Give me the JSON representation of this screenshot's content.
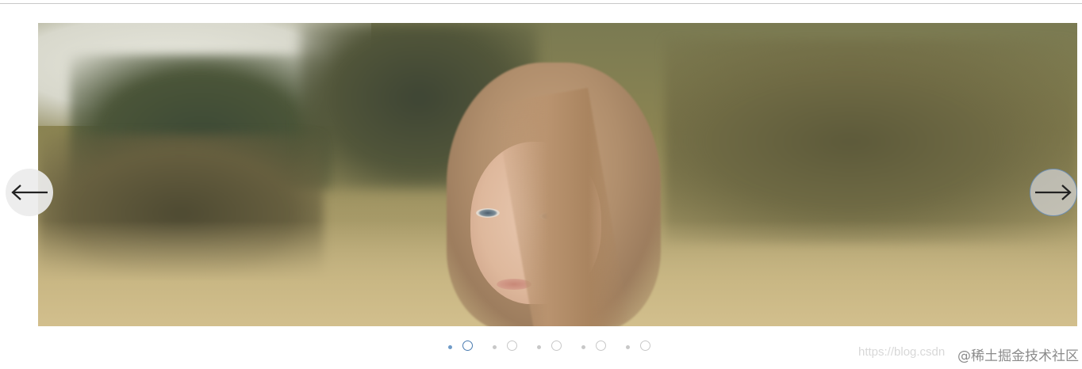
{
  "carousel": {
    "slides_count": 5,
    "active_index": 0,
    "prev_icon": "arrow-left-icon",
    "next_icon": "arrow-right-icon"
  },
  "watermark": {
    "url_text": "https://blog.csdn",
    "community_text": "@稀土掘金技术社区"
  },
  "colors": {
    "active_dot": "#4a7bb0",
    "inactive_dot": "#c8c8c8"
  }
}
